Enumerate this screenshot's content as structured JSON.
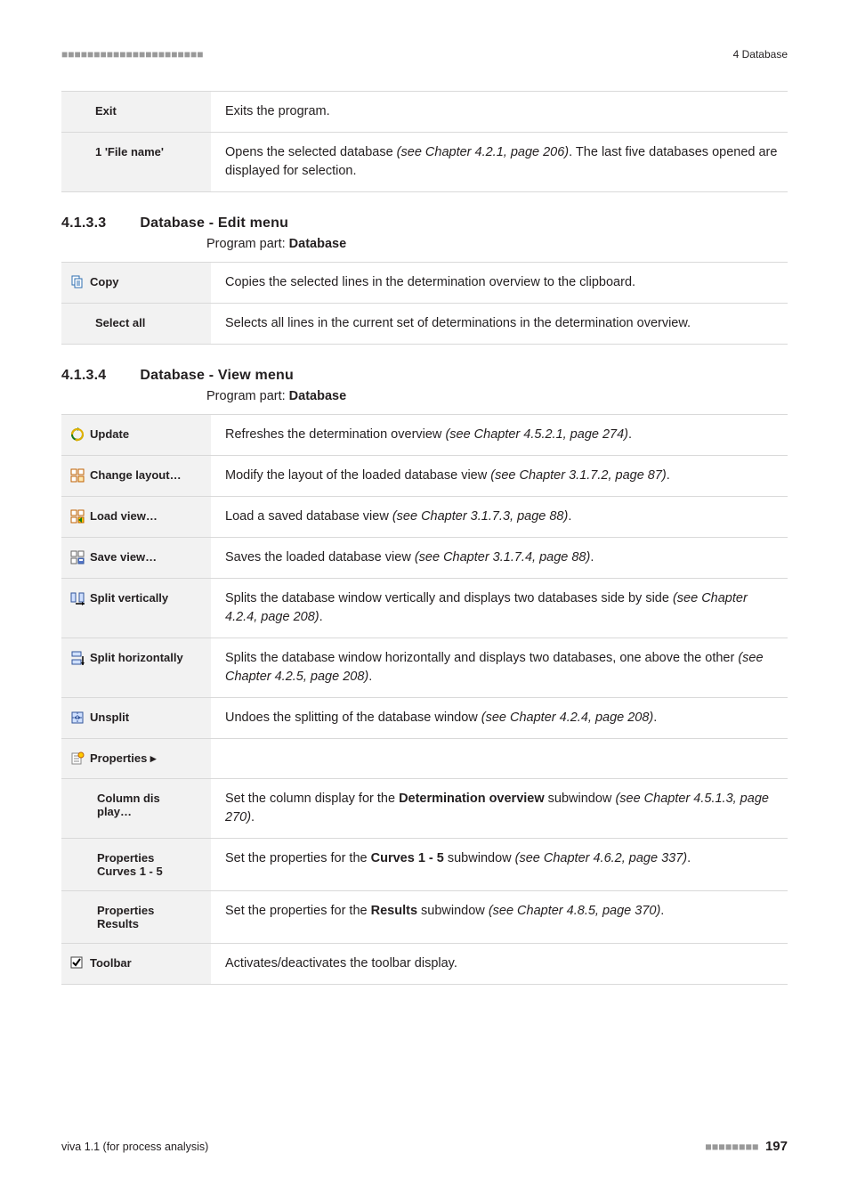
{
  "header": {
    "dashes": "■■■■■■■■■■■■■■■■■■■■■■",
    "right": "4 Database"
  },
  "table1": {
    "rows": [
      {
        "label": "Exit",
        "desc": "Exits the program."
      },
      {
        "label": "1 'File name'",
        "desc_pre": "Opens the selected database ",
        "desc_em": "(see Chapter 4.2.1, page 206)",
        "desc_post": ". The last five data­bases opened are displayed for selection."
      }
    ]
  },
  "sec1": {
    "num": "4.1.3.3",
    "title": "Database - Edit menu",
    "progpart_pre": "Program part: ",
    "progpart_b": "Database"
  },
  "table2": {
    "rows": [
      {
        "label": "Copy",
        "desc": "Copies the selected lines in the determination overview to the clipboard."
      },
      {
        "label": "Select all",
        "desc": "Selects all lines in the current set of determinations in the determination over­view."
      }
    ]
  },
  "sec2": {
    "num": "4.1.3.4",
    "title": "Database - View menu",
    "progpart_pre": "Program part: ",
    "progpart_b": "Database"
  },
  "table3": {
    "update": {
      "label": "Update",
      "pre": "Refreshes the determination overview ",
      "em": "(see Chapter 4.5.2.1, page 274)",
      "post": "."
    },
    "change": {
      "label": "Change layout…",
      "pre": "Modify the layout of the loaded database view ",
      "em": "(see Chapter 3.1.7.2, page 87)",
      "post": "."
    },
    "load": {
      "label": "Load view…",
      "pre": "Load a saved database view ",
      "em": "(see Chapter 3.1.7.3, page 88)",
      "post": "."
    },
    "save": {
      "label": "Save view…",
      "pre": "Saves the loaded database view ",
      "em": "(see Chapter 3.1.7.4, page 88)",
      "post": "."
    },
    "splitv": {
      "label": "Split vertically",
      "pre": "Splits the database window vertically and displays two databases side by side ",
      "em": "(see Chapter 4.2.4, page 208)",
      "post": "."
    },
    "splith": {
      "label": "Split horizontally",
      "pre": "Splits the database window horizontally and displays two databases, one above the other ",
      "em": "(see Chapter 4.2.5, page 208)",
      "post": "."
    },
    "unsplit": {
      "label": "Unsplit",
      "pre": "Undoes the splitting of the database window ",
      "em": "(see Chapter 4.2.4, page 208)",
      "post": "."
    },
    "props": {
      "label": "Properties ▸"
    },
    "coldisp": {
      "label1": "Column dis­",
      "label2": "play…",
      "pre": "Set the column display for the ",
      "b": "Determination overview",
      "mid": " subwindow ",
      "em": "(see Chapter 4.5.1.3, page 270)",
      "post": "."
    },
    "propcurves": {
      "label1": "Properties",
      "label2": "Curves 1 - 5",
      "pre": "Set the properties for the ",
      "b": "Curves 1 - 5",
      "mid": " subwindow ",
      "em": "(see Chapter 4.6.2, page 337)",
      "post": "."
    },
    "propresults": {
      "label1": "Properties",
      "label2": "Results",
      "pre": "Set the properties for the ",
      "b": "Results",
      "mid": " subwindow ",
      "em": "(see Chapter 4.8.5, page 370)",
      "post": "."
    },
    "toolbar": {
      "label": "Toolbar",
      "desc": "Activates/deactivates the toolbar display."
    }
  },
  "footer": {
    "left": "viva 1.1 (for process analysis)",
    "dashes": "■■■■■■■■",
    "page": "197"
  }
}
